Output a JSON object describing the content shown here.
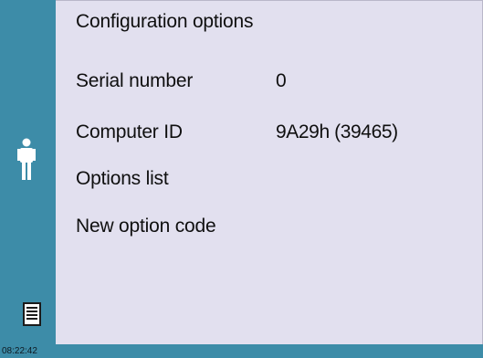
{
  "screen": {
    "title": "Configuration options",
    "time": "08:22:42"
  },
  "fields": [
    {
      "label": "Serial number",
      "value": "0"
    },
    {
      "label": "Computer  ID",
      "value": "9A29h (39465)"
    },
    {
      "label": "Options  list"
    },
    {
      "label": "New  option  code"
    }
  ],
  "icons": {
    "user": "person-icon",
    "list": "document-list-icon"
  },
  "colors": {
    "sidebar": "#3d8ca8",
    "panel_background": "#e2e0ef",
    "text": "#0f0f0f"
  }
}
